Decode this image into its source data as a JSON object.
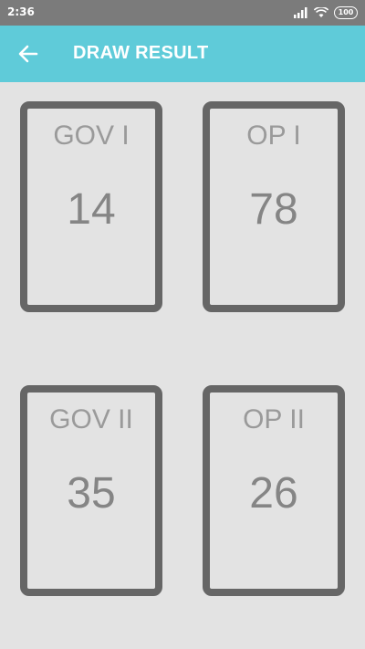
{
  "status_bar": {
    "time": "2:36",
    "battery": "100",
    "icons": [
      "signal-icon",
      "wifi-icon",
      "battery-icon"
    ]
  },
  "app_bar": {
    "title": "DRAW RESULT",
    "back_icon": "arrow-back-icon",
    "color": "#5fcbd9"
  },
  "results": [
    {
      "label": "GOV I",
      "value": "14"
    },
    {
      "label": "OP I",
      "value": "78"
    },
    {
      "label": "GOV II",
      "value": "35"
    },
    {
      "label": "OP II",
      "value": "26"
    }
  ]
}
